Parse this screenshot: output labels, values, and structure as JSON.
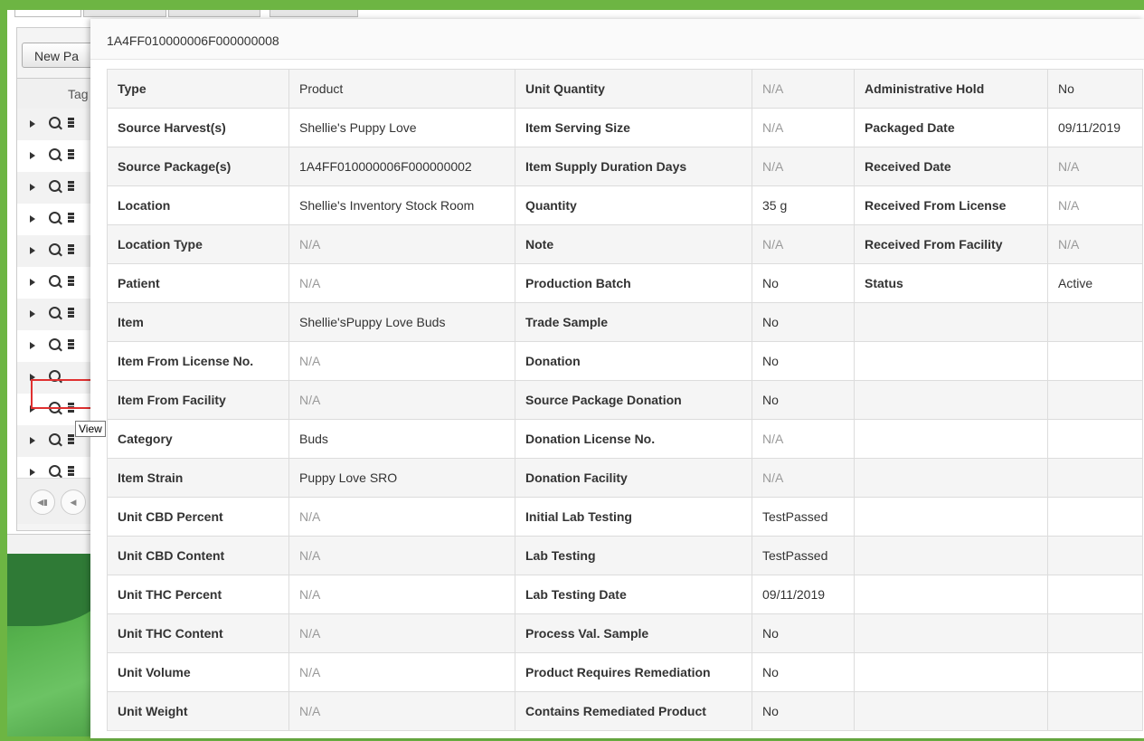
{
  "background": {
    "new_button": "New Pa",
    "column_header": "Tag",
    "row_count": 12,
    "highlighted_row": 9,
    "tooltip": "View"
  },
  "modal": {
    "title": "1A4FF010000006F000000008",
    "rows": [
      {
        "l1": "Type",
        "v1": "Product",
        "l2": "Unit Quantity",
        "v2": "N/A",
        "l3": "Administrative Hold",
        "v3": "No"
      },
      {
        "l1": "Source Harvest(s)",
        "v1": "Shellie's Puppy Love",
        "l2": "Item Serving Size",
        "v2": "N/A",
        "l3": "Packaged Date",
        "v3": "09/11/2019"
      },
      {
        "l1": "Source Package(s)",
        "v1": "1A4FF010000006F000000002",
        "l2": "Item Supply Duration Days",
        "v2": "N/A",
        "l3": "Received Date",
        "v3": "N/A"
      },
      {
        "l1": "Location",
        "v1": "Shellie's Inventory Stock Room",
        "l2": "Quantity",
        "v2": "35 g",
        "l3": "Received From License",
        "v3": "N/A"
      },
      {
        "l1": "Location Type",
        "v1": "N/A",
        "l2": "Note",
        "v2": "N/A",
        "l3": "Received From Facility",
        "v3": "N/A"
      },
      {
        "l1": "Patient",
        "v1": "N/A",
        "l2": "Production Batch",
        "v2": "No",
        "l3": "Status",
        "v3": "Active"
      },
      {
        "l1": "Item",
        "v1": "Shellie'sPuppy Love Buds",
        "l2": "Trade Sample",
        "v2": "No",
        "l3": "",
        "v3": ""
      },
      {
        "l1": "Item From License No.",
        "v1": "N/A",
        "l2": "Donation",
        "v2": "No",
        "l3": "",
        "v3": ""
      },
      {
        "l1": "Item From Facility",
        "v1": "N/A",
        "l2": "Source Package Donation",
        "v2": "No",
        "l3": "",
        "v3": ""
      },
      {
        "l1": "Category",
        "v1": "Buds",
        "l2": "Donation License No.",
        "v2": "N/A",
        "l3": "",
        "v3": ""
      },
      {
        "l1": "Item Strain",
        "v1": "Puppy Love SRO",
        "l2": "Donation Facility",
        "v2": "N/A",
        "l3": "",
        "v3": ""
      },
      {
        "l1": "Unit CBD Percent",
        "v1": "N/A",
        "l2": "Initial Lab Testing",
        "v2": "TestPassed",
        "l3": "",
        "v3": ""
      },
      {
        "l1": "Unit CBD Content",
        "v1": "N/A",
        "l2": "Lab Testing",
        "v2": "TestPassed",
        "l3": "",
        "v3": ""
      },
      {
        "l1": "Unit THC Percent",
        "v1": "N/A",
        "l2": "Lab Testing Date",
        "v2": "09/11/2019",
        "l3": "",
        "v3": ""
      },
      {
        "l1": "Unit THC Content",
        "v1": "N/A",
        "l2": "Process Val. Sample",
        "v2": "No",
        "l3": "",
        "v3": ""
      },
      {
        "l1": "Unit Volume",
        "v1": "N/A",
        "l2": "Product Requires Remediation",
        "v2": "No",
        "l3": "",
        "v3": ""
      },
      {
        "l1": "Unit Weight",
        "v1": "N/A",
        "l2": "Contains Remediated Product",
        "v2": "No",
        "l3": "",
        "v3": ""
      }
    ]
  }
}
